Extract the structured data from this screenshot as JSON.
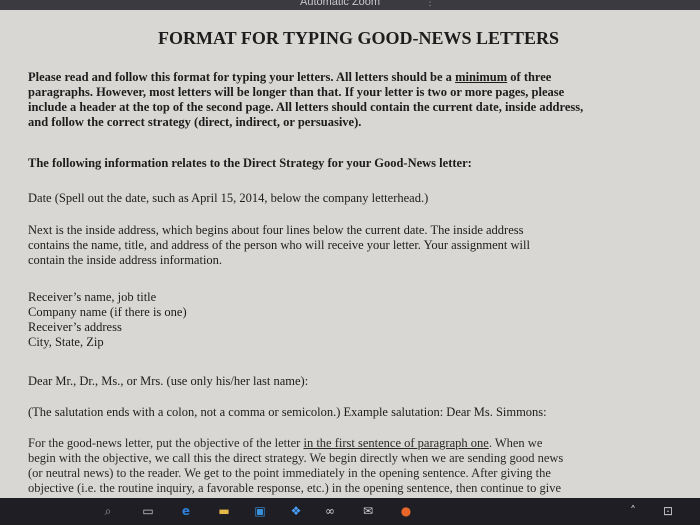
{
  "window": {
    "zoom_label": "Automatic Zoom",
    "zoom_menu_glyph": "⋮"
  },
  "document": {
    "title": "FORMAT FOR TYPING GOOD-NEWS LETTERS",
    "intro": {
      "line1_pre": "Please read and follow this format for typing your letters. All letters should be a ",
      "line1_underlined": "minimum",
      "line1_post": " of three",
      "line2": "paragraphs. However, most letters will be longer than that. If your letter is two or more pages, please",
      "line3": "include a header at the top of the second page. All letters should contain the current date, inside address,",
      "line4": "and follow the correct strategy (direct, indirect, or persuasive)."
    },
    "strategy_note": "The following information relates to the Direct Strategy for your Good-News letter:",
    "date_note": "Date (Spell out the date, such as April 15, 2014, below the company letterhead.)",
    "inside_address": {
      "line1": "Next is the inside address, which begins about four lines below the current date. The inside address",
      "line2": "contains the name, title, and address of the person who will receive your letter. Your assignment will",
      "line3": "contain the inside address information."
    },
    "address_block": [
      "Receiver’s name, job title",
      "Company name (if there is one)",
      "Receiver’s address",
      "City, State, Zip"
    ],
    "salutation": "Dear Mr., Dr., Ms., or Mrs. (use only his/her last name):",
    "salutation_note": "(The salutation ends with a colon, not a comma or semicolon.) Example salutation: Dear Ms. Simmons:",
    "good_news": {
      "line1_pre": "For the good-news letter, put the objective of the letter ",
      "line1_underlined": "in the first sentence of paragraph one",
      "line1_post": ". When we",
      "line2": "begin with the objective, we call this the direct strategy. We begin directly when we are sending good news",
      "line3": "(or neutral news) to the reader. We get to the point immediately in the opening sentence. After giving the",
      "line4": "objective (i.e. the routine inquiry, a favorable response, etc.) in the opening sentence, then continue to give"
    }
  },
  "taskbar": {
    "icons": [
      "search-icon",
      "task-view-icon",
      "edge-icon",
      "file-explorer-icon",
      "store-icon",
      "dropbox-icon",
      "infinity-icon",
      "mail-icon",
      "firefox-icon",
      "chevron-up-icon",
      "network-icon"
    ],
    "colors": {
      "edge": "#2f7fd6",
      "explorer": "#e6b84a",
      "dropbox": "#4aa3ff",
      "firefox": "#e8662a",
      "store": "#3b8fd9"
    }
  }
}
